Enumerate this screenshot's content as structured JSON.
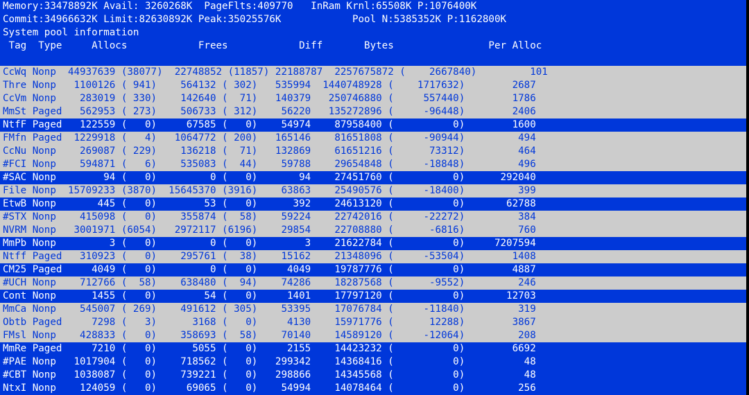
{
  "header": {
    "line1": "Memory:33478892K Avail: 3260268K  PageFlts:409770   InRam Krnl:65508K P:1076400K",
    "line2": "Commit:34966632K Limit:82630892K Peak:35025576K            Pool N:5385352K P:1162800K",
    "line3": "System pool information",
    "columns": " Tag  Type     Allocs            Frees            Diff       Bytes                Per Alloc"
  },
  "colors": {
    "highlight_bg": "#0037da",
    "normal_bg": "#cccccc",
    "highlight_fg": "#ffffff",
    "normal_fg": "#0037da"
  },
  "rows": [
    {
      "text": "CcWq Nonp  44937639 (38077)  22748852 (11857) 22188787  2257675872 (    2667840)         101",
      "highlight": false
    },
    {
      "text": "Thre Nonp   1100126 ( 941)    564132 ( 302)   535994  1440748928 (    1717632)        2687",
      "highlight": false
    },
    {
      "text": "CcVm Nonp    283019 ( 330)    142640 (  71)   140379   250746880 (     557440)        1786",
      "highlight": false
    },
    {
      "text": "MmSt Paged   562953 ( 273)    506733 ( 312)    56220   135272896 (     -96448)        2406",
      "highlight": false
    },
    {
      "text": "NtfF Paged   122559 (   0)     67585 (   0)    54974    87958400 (          0)        1600",
      "highlight": true
    },
    {
      "text": "FMfn Paged  1229918 (   4)   1064772 ( 200)   165146    81651808 (     -90944)         494",
      "highlight": false
    },
    {
      "text": "CcNu Nonp    269087 ( 229)    136218 (  71)   132869    61651216 (      73312)         464",
      "highlight": false
    },
    {
      "text": "#FCI Nonp    594871 (   6)    535083 (  44)    59788    29654848 (     -18848)         496",
      "highlight": false
    },
    {
      "text": "#SAC Nonp        94 (   0)         0 (   0)       94    27451760 (          0)      292040",
      "highlight": true
    },
    {
      "text": "File Nonp  15709233 (3870)  15645370 (3916)    63863    25490576 (     -18400)         399",
      "highlight": false
    },
    {
      "text": "EtwB Nonp       445 (   0)        53 (   0)      392    24613120 (          0)       62788",
      "highlight": true
    },
    {
      "text": "#STX Nonp    415098 (   0)    355874 (  58)    59224    22742016 (     -22272)         384",
      "highlight": false
    },
    {
      "text": "NVRM Nonp   3001971 (6054)   2972117 (6196)    29854    22708880 (      -6816)         760",
      "highlight": false
    },
    {
      "text": "MmPb Nonp         3 (   0)         0 (   0)        3    21622784 (          0)     7207594",
      "highlight": true
    },
    {
      "text": "Ntff Paged   310923 (   0)    295761 (  38)    15162    21348096 (     -53504)        1408",
      "highlight": false
    },
    {
      "text": "CM25 Paged     4049 (   0)         0 (   0)     4049    19787776 (          0)        4887",
      "highlight": true
    },
    {
      "text": "#UCH Nonp    712766 (  58)    638480 (  94)    74286    18287568 (      -9552)         246",
      "highlight": false
    },
    {
      "text": "Cont Nonp      1455 (   0)        54 (   0)     1401    17797120 (          0)       12703",
      "highlight": true
    },
    {
      "text": "MmCa Nonp    545007 ( 269)    491612 ( 305)    53395    17076784 (     -11840)         319",
      "highlight": false
    },
    {
      "text": "Obtb Paged     7298 (   3)      3168 (   0)     4130    15971776 (      12288)        3867",
      "highlight": false
    },
    {
      "text": "FMsl Nonp    428833 (   0)    358693 (  58)    70140    14589120 (     -12064)         208",
      "highlight": false
    },
    {
      "text": "MmRe Paged     7210 (   0)      5055 (   0)     2155    14423232 (          0)        6692",
      "highlight": true
    },
    {
      "text": "#PAE Nonp   1017904 (   0)    718562 (   0)   299342    14368416 (          0)          48",
      "highlight": true
    },
    {
      "text": "#CBT Nonp   1038087 (   0)    739221 (   0)   298866    14345568 (          0)          48",
      "highlight": true
    },
    {
      "text": "NtxI Nonp    124059 (   0)     69065 (   0)    54994    14078464 (          0)         256",
      "highlight": true
    }
  ]
}
